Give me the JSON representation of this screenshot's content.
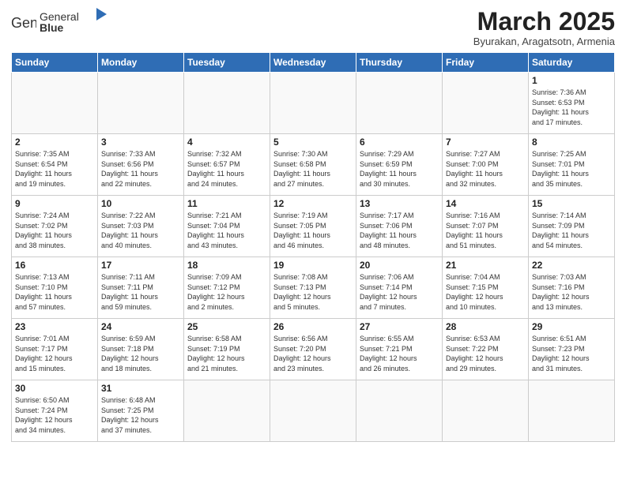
{
  "logo": {
    "text_normal": "General",
    "text_bold": "Blue"
  },
  "title": "March 2025",
  "subtitle": "Byurakan, Aragatsotn, Armenia",
  "weekdays": [
    "Sunday",
    "Monday",
    "Tuesday",
    "Wednesday",
    "Thursday",
    "Friday",
    "Saturday"
  ],
  "weeks": [
    [
      {
        "day": "",
        "info": ""
      },
      {
        "day": "",
        "info": ""
      },
      {
        "day": "",
        "info": ""
      },
      {
        "day": "",
        "info": ""
      },
      {
        "day": "",
        "info": ""
      },
      {
        "day": "",
        "info": ""
      },
      {
        "day": "1",
        "info": "Sunrise: 7:36 AM\nSunset: 6:53 PM\nDaylight: 11 hours\nand 17 minutes."
      }
    ],
    [
      {
        "day": "2",
        "info": "Sunrise: 7:35 AM\nSunset: 6:54 PM\nDaylight: 11 hours\nand 19 minutes."
      },
      {
        "day": "3",
        "info": "Sunrise: 7:33 AM\nSunset: 6:56 PM\nDaylight: 11 hours\nand 22 minutes."
      },
      {
        "day": "4",
        "info": "Sunrise: 7:32 AM\nSunset: 6:57 PM\nDaylight: 11 hours\nand 24 minutes."
      },
      {
        "day": "5",
        "info": "Sunrise: 7:30 AM\nSunset: 6:58 PM\nDaylight: 11 hours\nand 27 minutes."
      },
      {
        "day": "6",
        "info": "Sunrise: 7:29 AM\nSunset: 6:59 PM\nDaylight: 11 hours\nand 30 minutes."
      },
      {
        "day": "7",
        "info": "Sunrise: 7:27 AM\nSunset: 7:00 PM\nDaylight: 11 hours\nand 32 minutes."
      },
      {
        "day": "8",
        "info": "Sunrise: 7:25 AM\nSunset: 7:01 PM\nDaylight: 11 hours\nand 35 minutes."
      }
    ],
    [
      {
        "day": "9",
        "info": "Sunrise: 7:24 AM\nSunset: 7:02 PM\nDaylight: 11 hours\nand 38 minutes."
      },
      {
        "day": "10",
        "info": "Sunrise: 7:22 AM\nSunset: 7:03 PM\nDaylight: 11 hours\nand 40 minutes."
      },
      {
        "day": "11",
        "info": "Sunrise: 7:21 AM\nSunset: 7:04 PM\nDaylight: 11 hours\nand 43 minutes."
      },
      {
        "day": "12",
        "info": "Sunrise: 7:19 AM\nSunset: 7:05 PM\nDaylight: 11 hours\nand 46 minutes."
      },
      {
        "day": "13",
        "info": "Sunrise: 7:17 AM\nSunset: 7:06 PM\nDaylight: 11 hours\nand 48 minutes."
      },
      {
        "day": "14",
        "info": "Sunrise: 7:16 AM\nSunset: 7:07 PM\nDaylight: 11 hours\nand 51 minutes."
      },
      {
        "day": "15",
        "info": "Sunrise: 7:14 AM\nSunset: 7:09 PM\nDaylight: 11 hours\nand 54 minutes."
      }
    ],
    [
      {
        "day": "16",
        "info": "Sunrise: 7:13 AM\nSunset: 7:10 PM\nDaylight: 11 hours\nand 57 minutes."
      },
      {
        "day": "17",
        "info": "Sunrise: 7:11 AM\nSunset: 7:11 PM\nDaylight: 11 hours\nand 59 minutes."
      },
      {
        "day": "18",
        "info": "Sunrise: 7:09 AM\nSunset: 7:12 PM\nDaylight: 12 hours\nand 2 minutes."
      },
      {
        "day": "19",
        "info": "Sunrise: 7:08 AM\nSunset: 7:13 PM\nDaylight: 12 hours\nand 5 minutes."
      },
      {
        "day": "20",
        "info": "Sunrise: 7:06 AM\nSunset: 7:14 PM\nDaylight: 12 hours\nand 7 minutes."
      },
      {
        "day": "21",
        "info": "Sunrise: 7:04 AM\nSunset: 7:15 PM\nDaylight: 12 hours\nand 10 minutes."
      },
      {
        "day": "22",
        "info": "Sunrise: 7:03 AM\nSunset: 7:16 PM\nDaylight: 12 hours\nand 13 minutes."
      }
    ],
    [
      {
        "day": "23",
        "info": "Sunrise: 7:01 AM\nSunset: 7:17 PM\nDaylight: 12 hours\nand 15 minutes."
      },
      {
        "day": "24",
        "info": "Sunrise: 6:59 AM\nSunset: 7:18 PM\nDaylight: 12 hours\nand 18 minutes."
      },
      {
        "day": "25",
        "info": "Sunrise: 6:58 AM\nSunset: 7:19 PM\nDaylight: 12 hours\nand 21 minutes."
      },
      {
        "day": "26",
        "info": "Sunrise: 6:56 AM\nSunset: 7:20 PM\nDaylight: 12 hours\nand 23 minutes."
      },
      {
        "day": "27",
        "info": "Sunrise: 6:55 AM\nSunset: 7:21 PM\nDaylight: 12 hours\nand 26 minutes."
      },
      {
        "day": "28",
        "info": "Sunrise: 6:53 AM\nSunset: 7:22 PM\nDaylight: 12 hours\nand 29 minutes."
      },
      {
        "day": "29",
        "info": "Sunrise: 6:51 AM\nSunset: 7:23 PM\nDaylight: 12 hours\nand 31 minutes."
      }
    ],
    [
      {
        "day": "30",
        "info": "Sunrise: 6:50 AM\nSunset: 7:24 PM\nDaylight: 12 hours\nand 34 minutes."
      },
      {
        "day": "31",
        "info": "Sunrise: 6:48 AM\nSunset: 7:25 PM\nDaylight: 12 hours\nand 37 minutes."
      },
      {
        "day": "",
        "info": ""
      },
      {
        "day": "",
        "info": ""
      },
      {
        "day": "",
        "info": ""
      },
      {
        "day": "",
        "info": ""
      },
      {
        "day": "",
        "info": ""
      }
    ]
  ]
}
